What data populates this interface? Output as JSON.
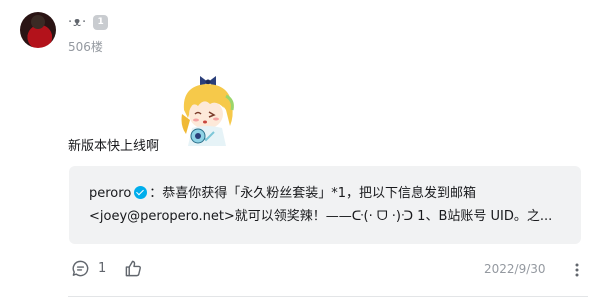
{
  "comment": {
    "username": "·ᴥ·",
    "level_badge": "1",
    "floor": "506楼",
    "sticker_icon": "anime-girl-sticker",
    "text": "新版本快上线啊",
    "reply": {
      "user": "peroro",
      "verified": true,
      "line1_rest": "：恭喜你获得「永久粉丝套装」*1，把以下信息发到邮箱",
      "line2": "<joey@peropero.net>就可以领奖辣！——ᑢ(· ᗜ ·)ᑝ 1、B站账号 UID。之..."
    },
    "actions": {
      "reply_icon": "comment-bubble-icon",
      "reply_count": "1",
      "like_icon": "thumbs-up-icon"
    },
    "date": "2022/9/30",
    "more_icon": "more-vertical-icon"
  }
}
